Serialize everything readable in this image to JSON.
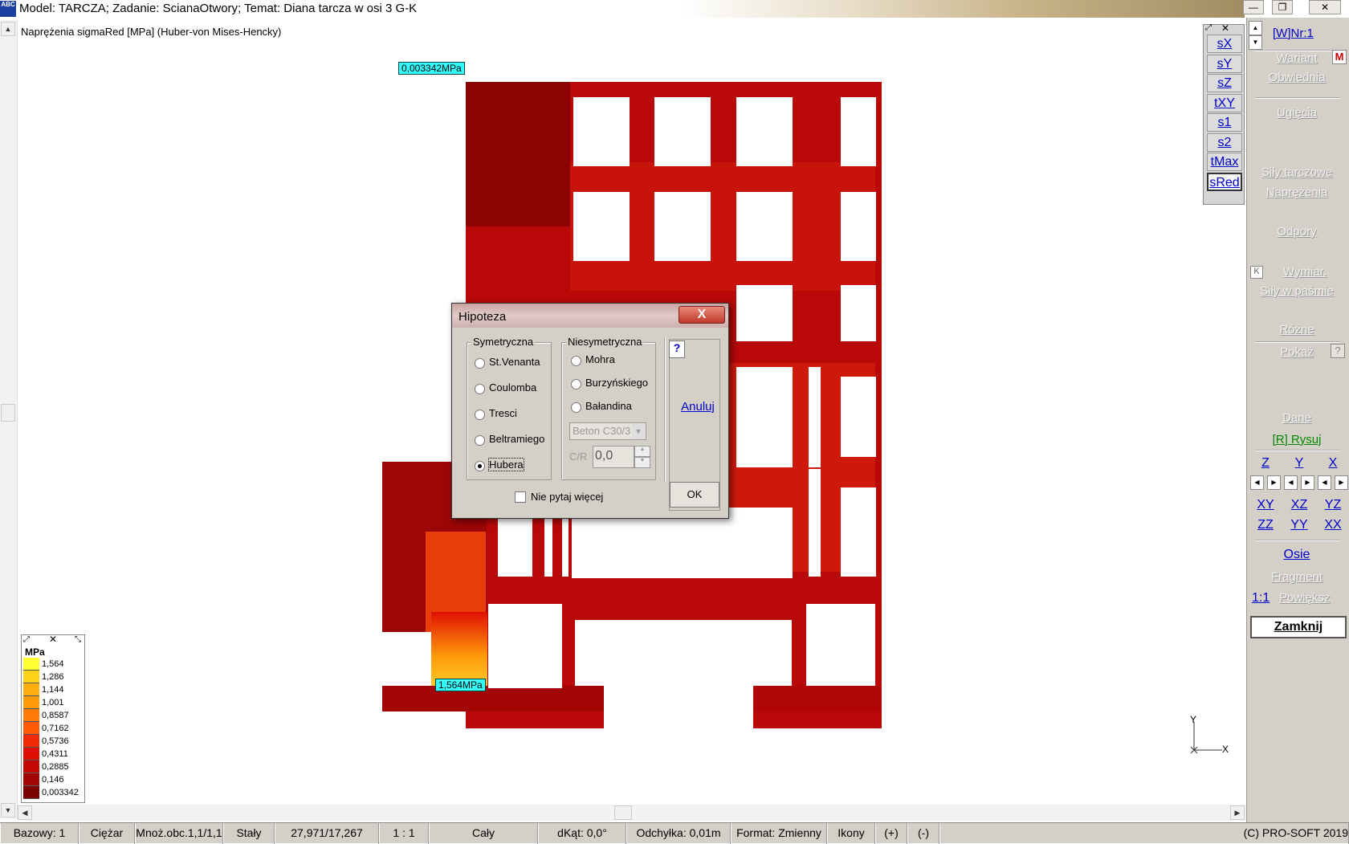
{
  "titlebar": {
    "app_icon_text": "ABC",
    "title": "Model: TARCZA;  Zadanie: ScianaOtwory;  Temat: Diana tarcza w osi 3 G-K"
  },
  "canvas": {
    "subtitle": "Naprężenia sigmaRed [MPa]  (Huber-von Mises-Hencky)",
    "min_callout": "0,003342MPa",
    "max_callout": "1,564MPa",
    "axis_y": "Y",
    "axis_x": "X"
  },
  "legend": {
    "unit": "MPa",
    "entries": [
      {
        "value": "1,564",
        "color": "#ffff33"
      },
      {
        "value": "1,286",
        "color": "#ffd21a"
      },
      {
        "value": "1,144",
        "color": "#ffae0f"
      },
      {
        "value": "1,001",
        "color": "#ff9a0a"
      },
      {
        "value": "0,8587",
        "color": "#ff7b08"
      },
      {
        "value": "0,7162",
        "color": "#ff5a05"
      },
      {
        "value": "0,5736",
        "color": "#f02a03"
      },
      {
        "value": "0,4311",
        "color": "#e01002"
      },
      {
        "value": "0,2885",
        "color": "#c40804"
      },
      {
        "value": "0,146",
        "color": "#a30404"
      },
      {
        "value": "0,003342",
        "color": "#7a0202"
      }
    ]
  },
  "stress_buttons": [
    "sX",
    "sY",
    "sZ",
    "tXY",
    "s1",
    "s2",
    "tMax",
    "sRed"
  ],
  "rpanel": {
    "wnr": "[W]Nr:1",
    "wariant": "Wariant",
    "wariant_badge": "M",
    "obwiednia": "Obwiednia",
    "ugiecia": "Ugięcia",
    "sily_tarczowe": "Siły tarczowe",
    "naprezenia": "Naprężenia",
    "odpory": "Odpory",
    "k_badge": "K",
    "wymiar": "Wymiar.",
    "sily_w_pasmie": "Siły w paśmie",
    "rozne": "Różne",
    "pokaz": "Pokaż",
    "help": "?",
    "dane": "Dane",
    "rysuj": "[R] Rysuj",
    "views1": [
      "Z",
      "Y",
      "X"
    ],
    "views2": [
      "XY",
      "XZ",
      "YZ"
    ],
    "views3": [
      "ZZ",
      "YY",
      "XX"
    ],
    "osie": "Osie",
    "fragment": "Fragment",
    "scale": "1:1",
    "powieksz": "Powiększ",
    "zamknij": "Zamknij"
  },
  "dialog": {
    "title": "Hipoteza",
    "close": "X",
    "sym_group": "Symetryczna",
    "sym_options": [
      "St.Venanta",
      "Coulomba",
      "Tresci",
      "Beltramiego",
      "Hubera"
    ],
    "sym_selected": "Hubera",
    "nonsym_group": "Niesymetryczna",
    "nonsym_options": [
      "Mohra",
      "Burzyńskiego",
      "Bałandina"
    ],
    "material": "Beton C30/3",
    "cr_label": "C/R",
    "cr_value": "0,0",
    "help": "?",
    "cancel": "Anuluj",
    "ok": "OK",
    "dont_ask": "Nie pytaj więcej"
  },
  "status": {
    "cells": [
      "Bazowy: 1",
      "Ciężar",
      "Mnoż.obc.1,1/1,1",
      "Stały",
      "27,971/17,267",
      "1 : 1",
      "Cały",
      "dKąt: 0,0°",
      "Odchyłka: 0,01m",
      "Format: Zmienny",
      "Ikony",
      "(+)",
      "(-)",
      "(C) PRO-SOFT 2019"
    ]
  }
}
